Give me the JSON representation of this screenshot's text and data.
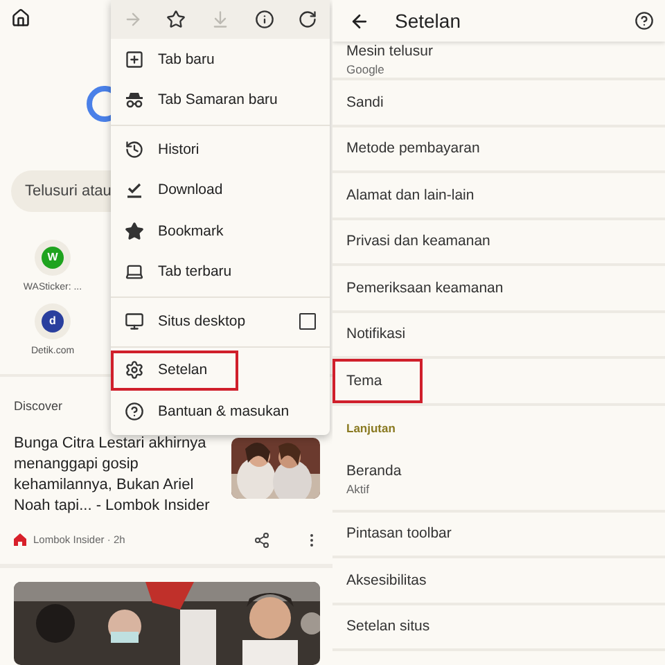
{
  "browser_home": {
    "search": {
      "placeholder": "Telusuri atau"
    },
    "shortcuts": [
      {
        "icon_text": "W",
        "label": "WASticker: ...",
        "color": "#1fa31f"
      },
      {
        "icon_text": "d",
        "label": "Detik.com",
        "color": "#2a3f9e"
      }
    ],
    "discover": {
      "label": "Discover"
    },
    "articles": [
      {
        "kind": "story",
        "title": "Bunga Citra Lestari akhirnya menanggapi gosip kehamilannya, Bukan Ariel Noah tapi... - Lombok Insider",
        "source": "Lombok Insider · 2h"
      },
      {
        "kind": "picture"
      }
    ]
  },
  "menu": {
    "toolbar": [
      {
        "kind": "forward",
        "disabled": true
      },
      {
        "kind": "star",
        "disabled": false
      },
      {
        "kind": "download",
        "disabled": true
      },
      {
        "kind": "info",
        "disabled": false
      },
      {
        "kind": "refresh",
        "disabled": false
      }
    ],
    "sections": [
      [
        {
          "kind": "item",
          "label": "Tab baru",
          "highlighted": false
        },
        {
          "kind": "item",
          "label": "Tab Samaran baru",
          "highlighted": false
        }
      ],
      [
        {
          "kind": "item",
          "label": "Histori",
          "highlighted": false
        },
        {
          "kind": "item",
          "label": "Download",
          "highlighted": false
        },
        {
          "kind": "item",
          "label": "Bookmark",
          "highlighted": false
        },
        {
          "kind": "item",
          "label": "Tab terbaru",
          "highlighted": false
        }
      ],
      [
        {
          "kind": "checkbox",
          "label": "Situs desktop",
          "checked": false
        }
      ],
      [
        {
          "kind": "item",
          "label": "Setelan",
          "highlighted": true
        },
        {
          "kind": "item",
          "label": "Bantuan & masukan",
          "highlighted": false
        }
      ]
    ]
  },
  "settings": {
    "title": "Setelan",
    "items": [
      {
        "kind": "item",
        "label": "Mesin telusur",
        "sublabel": "Google",
        "highlighted": false
      },
      {
        "kind": "item",
        "label": "Sandi",
        "highlighted": false
      },
      {
        "kind": "item",
        "label": "Metode pembayaran",
        "highlighted": false
      },
      {
        "kind": "item",
        "label": "Alamat dan lain-lain",
        "highlighted": false
      },
      {
        "kind": "item",
        "label": "Privasi dan keamanan",
        "highlighted": false
      },
      {
        "kind": "item",
        "label": "Pemeriksaan keamanan",
        "highlighted": false
      },
      {
        "kind": "item",
        "label": "Notifikasi",
        "highlighted": false
      },
      {
        "kind": "item",
        "label": "Tema",
        "highlighted": true
      },
      {
        "kind": "section",
        "label": "Lanjutan"
      },
      {
        "kind": "item",
        "label": "Beranda",
        "sublabel": "Aktif",
        "highlighted": false
      },
      {
        "kind": "item",
        "label": "Pintasan toolbar",
        "highlighted": false
      },
      {
        "kind": "item",
        "label": "Aksesibilitas",
        "highlighted": false
      },
      {
        "kind": "item",
        "label": "Setelan situs",
        "highlighted": false
      }
    ]
  }
}
